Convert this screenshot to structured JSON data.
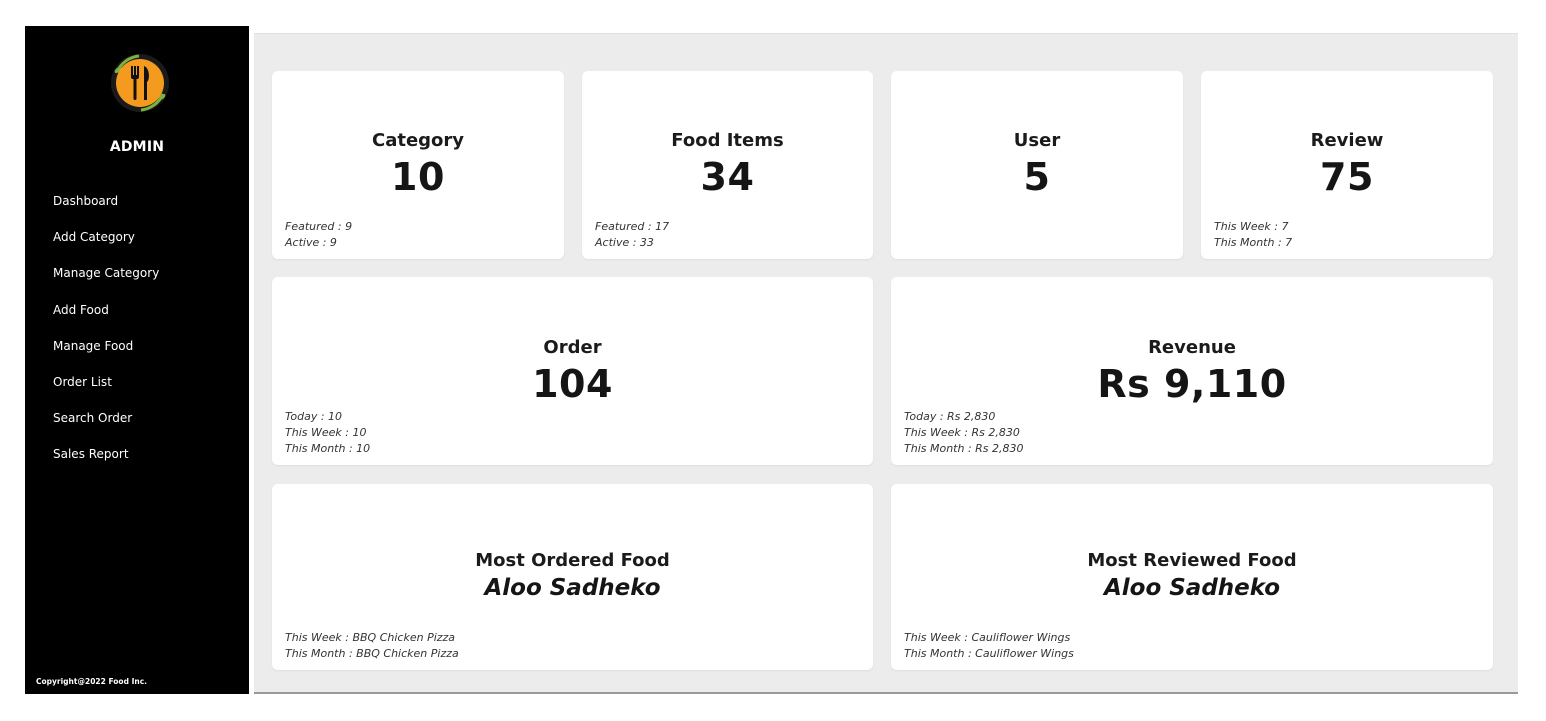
{
  "sidebar": {
    "logo_icon": "fork-knife-logo-icon",
    "admin_label": "ADMIN",
    "items": [
      {
        "label": "Dashboard"
      },
      {
        "label": "Add Category"
      },
      {
        "label": "Manage Category"
      },
      {
        "label": "Add Food"
      },
      {
        "label": "Manage Food"
      },
      {
        "label": "Order List"
      },
      {
        "label": "Search Order"
      },
      {
        "label": "Sales Report"
      }
    ],
    "copyright": "Copyright@2022 Food Inc."
  },
  "cards": {
    "category": {
      "title": "Category",
      "value": "10",
      "stats": [
        "Featured : 9",
        "Active : 9"
      ]
    },
    "food_items": {
      "title": "Food Items",
      "value": "34",
      "stats": [
        "Featured : 17",
        "Active : 33"
      ]
    },
    "user": {
      "title": "User",
      "value": "5"
    },
    "review": {
      "title": "Review",
      "value": "75",
      "stats": [
        "This Week : 7",
        "This Month : 7"
      ]
    },
    "order": {
      "title": "Order",
      "value": "104",
      "stats": [
        "Today : 10",
        "This Week : 10",
        "This Month : 10"
      ]
    },
    "revenue": {
      "title": "Revenue",
      "value": "Rs 9,110",
      "stats": [
        "Today : Rs 2,830",
        "This Week : Rs 2,830",
        "This Month : Rs 2,830"
      ]
    },
    "most_ordered": {
      "title": "Most Ordered Food",
      "value": "Aloo Sadheko",
      "stats": [
        "This Week : BBQ Chicken Pizza",
        "This Month : BBQ Chicken Pizza"
      ]
    },
    "most_reviewed": {
      "title": "Most Reviewed Food",
      "value": "Aloo Sadheko",
      "stats": [
        "This Week : Cauliflower Wings",
        "This Month : Cauliflower Wings"
      ]
    }
  },
  "colors": {
    "sidebar_bg": "#000000",
    "main_bg": "#ececec",
    "card_bg": "#ffffff",
    "logo_orange": "#f39a1f",
    "logo_green": "#7bb241"
  }
}
